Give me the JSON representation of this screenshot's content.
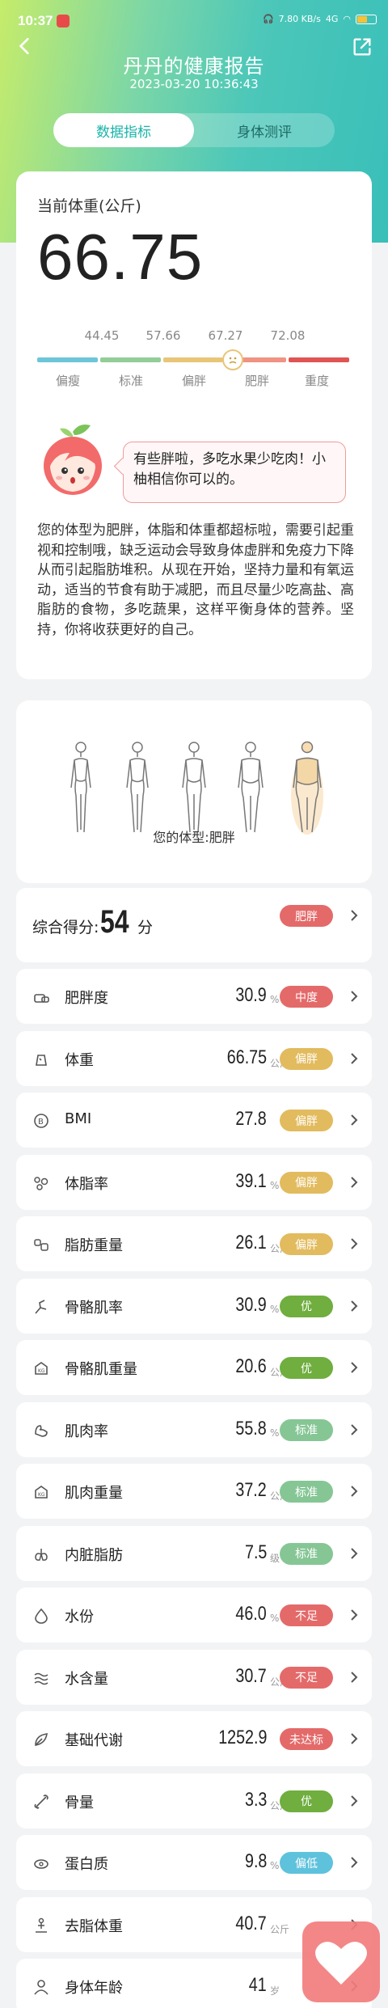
{
  "status": {
    "time": "10:37",
    "net": "7.80 KB/s",
    "signal": "4G"
  },
  "header": {
    "title": "丹丹的健康报告",
    "datetime": "2023-03-20 10:36:43"
  },
  "tabs": [
    {
      "label": "数据指标",
      "active": true
    },
    {
      "label": "身体测评",
      "active": false
    }
  ],
  "weight": {
    "label": "当前体重(公斤)",
    "value": "66.75",
    "thresholds": [
      "44.45",
      "57.66",
      "67.27",
      "72.08"
    ],
    "categories": [
      "偏瘦",
      "标准",
      "偏胖",
      "肥胖",
      "重度"
    ],
    "colors": [
      "#6cc6d8",
      "#93cd98",
      "#e8c678",
      "#f09382",
      "#df5454"
    ]
  },
  "assistant": {
    "bubble": "有些胖啦，多吃水果少吃肉！小柚相信你可以的。"
  },
  "description": "您的体型为肥胖，体脂和体重都超标啦，需要引起重视和控制哦，缺乏运动会导致身体虚胖和免疫力下降从而引起脂肪堆积。从现在开始，坚持力量和有氧运动，适当的节食有助于减肥，而且尽量少吃高盐、高脂肪的食物，多吃蔬果，这样平衡身体的营养。坚持，你将收获更好的自己。",
  "body_type": {
    "label": "您的体型:肥胖",
    "selected": 5
  },
  "score": {
    "label": "综合得分:",
    "value": "54",
    "unit": "分",
    "badge": "肥胖",
    "badge_color": "#e46a6a"
  },
  "metrics": [
    {
      "icon": "obesity-icon",
      "name": "肥胖度",
      "value": "30.9",
      "unit": "%",
      "badge": "中度",
      "color": "#e46a6a"
    },
    {
      "icon": "weight-icon",
      "name": "体重",
      "value": "66.75",
      "unit": "公斤",
      "badge": "偏胖",
      "color": "#e2bb5e"
    },
    {
      "icon": "bmi-icon",
      "name": "BMI",
      "value": "27.8",
      "unit": "",
      "badge": "偏胖",
      "color": "#e2bb5e"
    },
    {
      "icon": "body-fat-icon",
      "name": "体脂率",
      "value": "39.1",
      "unit": "%",
      "badge": "偏胖",
      "color": "#e2bb5e"
    },
    {
      "icon": "fat-mass-icon",
      "name": "脂肪重量",
      "value": "26.1",
      "unit": "公斤",
      "badge": "偏胖",
      "color": "#e2bb5e"
    },
    {
      "icon": "skeletal-muscle-icon",
      "name": "骨骼肌率",
      "value": "30.9",
      "unit": "%",
      "badge": "优",
      "color": "#6fae3f"
    },
    {
      "icon": "skeletal-muscle-mass-icon",
      "name": "骨骼肌重量",
      "value": "20.6",
      "unit": "公斤",
      "badge": "优",
      "color": "#6fae3f"
    },
    {
      "icon": "muscle-icon",
      "name": "肌肉率",
      "value": "55.8",
      "unit": "%",
      "badge": "标准",
      "color": "#86c695"
    },
    {
      "icon": "muscle-mass-icon",
      "name": "肌肉重量",
      "value": "37.2",
      "unit": "公斤",
      "badge": "标准",
      "color": "#86c695"
    },
    {
      "icon": "visceral-fat-icon",
      "name": "内脏脂肪",
      "value": "7.5",
      "unit": "级",
      "badge": "标准",
      "color": "#86c695"
    },
    {
      "icon": "water-icon",
      "name": "水份",
      "value": "46.0",
      "unit": "%",
      "badge": "不足",
      "color": "#e46a6a"
    },
    {
      "icon": "water-content-icon",
      "name": "水含量",
      "value": "30.7",
      "unit": "公斤",
      "badge": "不足",
      "color": "#e46a6a"
    },
    {
      "icon": "metabolism-icon",
      "name": "基础代谢",
      "value": "1252.9",
      "unit": "",
      "badge": "未达标",
      "color": "#e46a6a"
    },
    {
      "icon": "bone-icon",
      "name": "骨量",
      "value": "3.3",
      "unit": "公斤",
      "badge": "优",
      "color": "#6fae3f"
    },
    {
      "icon": "protein-icon",
      "name": "蛋白质",
      "value": "9.8",
      "unit": "%",
      "badge": "偏低",
      "color": "#5ec2dc"
    },
    {
      "icon": "lean-mass-icon",
      "name": "去脂体重",
      "value": "40.7",
      "unit": "公斤",
      "badge": "",
      "color": ""
    },
    {
      "icon": "body-age-icon",
      "name": "身体年龄",
      "value": "41",
      "unit": "岁",
      "badge": "",
      "color": ""
    }
  ]
}
